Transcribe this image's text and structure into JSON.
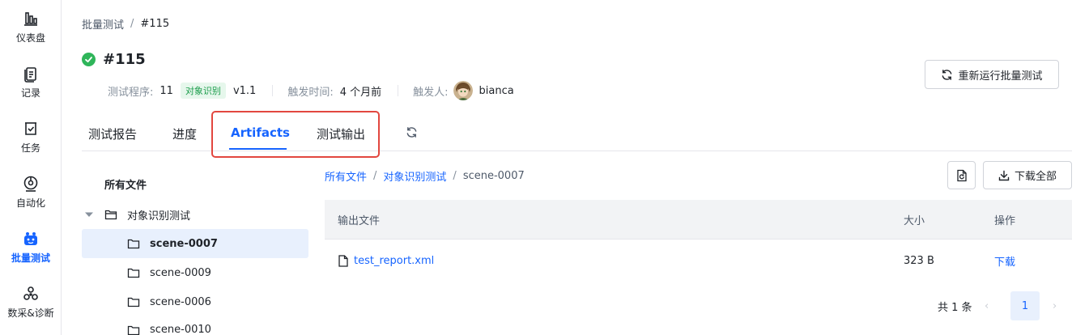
{
  "sidebar": {
    "items": [
      {
        "label": "仪表盘",
        "icon": "dashboard-icon"
      },
      {
        "label": "记录",
        "icon": "records-icon"
      },
      {
        "label": "任务",
        "icon": "tasks-icon"
      },
      {
        "label": "自动化",
        "icon": "automation-icon"
      },
      {
        "label": "批量测试",
        "icon": "batch-test-icon",
        "active": true
      },
      {
        "label": "数采&诊断",
        "icon": "diagnosis-icon"
      }
    ]
  },
  "breadcrumb": {
    "parent": "批量测试",
    "sep": "/",
    "current": "#115"
  },
  "header": {
    "title": "#115",
    "status": "success",
    "meta": {
      "program_label": "测试程序:",
      "program_value": "11",
      "tag": "对象识别",
      "version": "v1.1",
      "trigger_time_label": "触发时间:",
      "trigger_time_value": "4 个月前",
      "trigger_user_label": "触发人:",
      "trigger_user_value": "bianca"
    },
    "rerun_label": "重新运行批量测试"
  },
  "tabs": [
    {
      "label": "测试报告"
    },
    {
      "label": "进度"
    },
    {
      "label": "Artifacts",
      "active": true
    },
    {
      "label": "测试输出"
    }
  ],
  "file_tree": {
    "title": "所有文件",
    "root": "对象识别测试",
    "children": [
      "scene-0007",
      "scene-0009",
      "scene-0006",
      "scene-0010"
    ],
    "selected": "scene-0007"
  },
  "path": {
    "crumbs": [
      "所有文件",
      "对象识别测试"
    ],
    "sep": "/",
    "current": "scene-0007"
  },
  "actions": {
    "download_all": "下载全部"
  },
  "table": {
    "columns": [
      "输出文件",
      "大小",
      "操作"
    ],
    "rows": [
      {
        "file": "test_report.xml",
        "size": "323 B",
        "action": "下载"
      }
    ]
  },
  "pagination": {
    "total": "共 1 条",
    "prev": "‹",
    "current": "1",
    "next": "›"
  },
  "colors": {
    "accent": "#1664ff",
    "success": "#2fb55a",
    "highlight": "#e2473f"
  }
}
